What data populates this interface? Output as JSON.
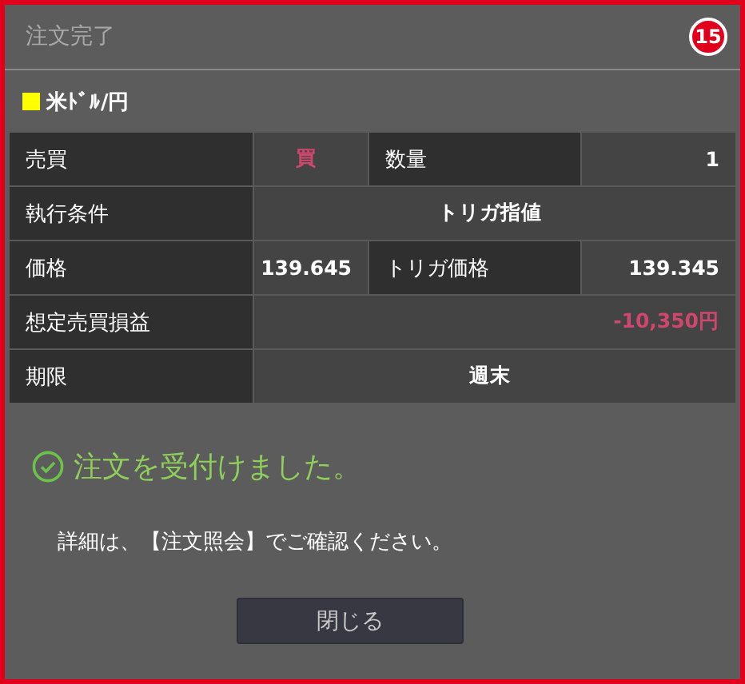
{
  "dialog": {
    "title": "注文完了",
    "badge": "15"
  },
  "pair": {
    "name": "米ﾄﾞﾙ/円",
    "color": "#ffff00"
  },
  "rows": [
    {
      "kind": "pair",
      "cells": [
        {
          "label": "売買",
          "value": "買",
          "centered": true,
          "negative": true
        },
        {
          "label": "数量",
          "value": "1",
          "centered": false,
          "negative": false
        }
      ]
    },
    {
      "kind": "single",
      "cells": [
        {
          "label": "執行条件",
          "value": "トリガ指値",
          "centered": true,
          "negative": false
        }
      ]
    },
    {
      "kind": "pair",
      "cells": [
        {
          "label": "価格",
          "value": "139.645",
          "centered": false,
          "negative": false
        },
        {
          "label": "トリガ価格",
          "value": "139.345",
          "centered": false,
          "negative": false
        }
      ]
    },
    {
      "kind": "single",
      "cells": [
        {
          "label": "想定売買損益",
          "value": "-10,350円",
          "centered": false,
          "negative": true
        }
      ]
    },
    {
      "kind": "single",
      "cells": [
        {
          "label": "期限",
          "value": "週末",
          "centered": true,
          "negative": false
        }
      ]
    }
  ],
  "message": "注文を受付けました。",
  "detail": "詳細は、【注文照会】でご確認ください。",
  "buttons": [
    "閉じる"
  ]
}
